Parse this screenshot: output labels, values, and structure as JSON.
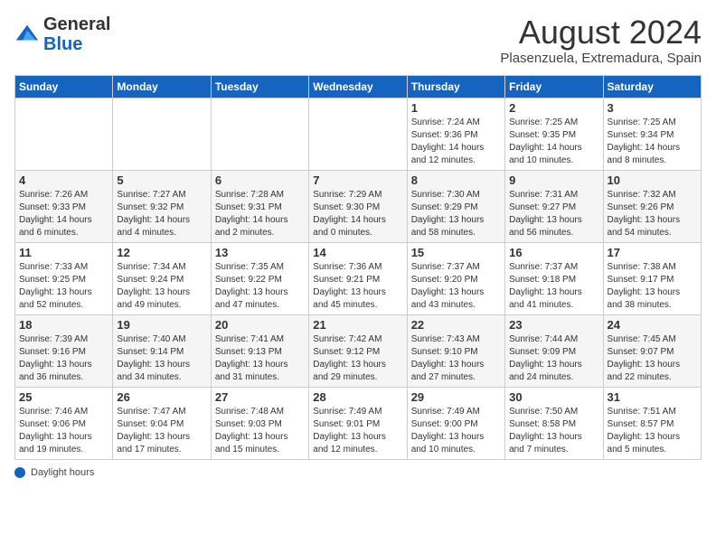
{
  "header": {
    "logo_general": "General",
    "logo_blue": "Blue",
    "month_title": "August 2024",
    "location": "Plasenzuela, Extremadura, Spain"
  },
  "days_of_week": [
    "Sunday",
    "Monday",
    "Tuesday",
    "Wednesday",
    "Thursday",
    "Friday",
    "Saturday"
  ],
  "weeks": [
    [
      {
        "day": "",
        "info": ""
      },
      {
        "day": "",
        "info": ""
      },
      {
        "day": "",
        "info": ""
      },
      {
        "day": "",
        "info": ""
      },
      {
        "day": "1",
        "info": "Sunrise: 7:24 AM\nSunset: 9:36 PM\nDaylight: 14 hours\nand 12 minutes."
      },
      {
        "day": "2",
        "info": "Sunrise: 7:25 AM\nSunset: 9:35 PM\nDaylight: 14 hours\nand 10 minutes."
      },
      {
        "day": "3",
        "info": "Sunrise: 7:25 AM\nSunset: 9:34 PM\nDaylight: 14 hours\nand 8 minutes."
      }
    ],
    [
      {
        "day": "4",
        "info": "Sunrise: 7:26 AM\nSunset: 9:33 PM\nDaylight: 14 hours\nand 6 minutes."
      },
      {
        "day": "5",
        "info": "Sunrise: 7:27 AM\nSunset: 9:32 PM\nDaylight: 14 hours\nand 4 minutes."
      },
      {
        "day": "6",
        "info": "Sunrise: 7:28 AM\nSunset: 9:31 PM\nDaylight: 14 hours\nand 2 minutes."
      },
      {
        "day": "7",
        "info": "Sunrise: 7:29 AM\nSunset: 9:30 PM\nDaylight: 14 hours\nand 0 minutes."
      },
      {
        "day": "8",
        "info": "Sunrise: 7:30 AM\nSunset: 9:29 PM\nDaylight: 13 hours\nand 58 minutes."
      },
      {
        "day": "9",
        "info": "Sunrise: 7:31 AM\nSunset: 9:27 PM\nDaylight: 13 hours\nand 56 minutes."
      },
      {
        "day": "10",
        "info": "Sunrise: 7:32 AM\nSunset: 9:26 PM\nDaylight: 13 hours\nand 54 minutes."
      }
    ],
    [
      {
        "day": "11",
        "info": "Sunrise: 7:33 AM\nSunset: 9:25 PM\nDaylight: 13 hours\nand 52 minutes."
      },
      {
        "day": "12",
        "info": "Sunrise: 7:34 AM\nSunset: 9:24 PM\nDaylight: 13 hours\nand 49 minutes."
      },
      {
        "day": "13",
        "info": "Sunrise: 7:35 AM\nSunset: 9:22 PM\nDaylight: 13 hours\nand 47 minutes."
      },
      {
        "day": "14",
        "info": "Sunrise: 7:36 AM\nSunset: 9:21 PM\nDaylight: 13 hours\nand 45 minutes."
      },
      {
        "day": "15",
        "info": "Sunrise: 7:37 AM\nSunset: 9:20 PM\nDaylight: 13 hours\nand 43 minutes."
      },
      {
        "day": "16",
        "info": "Sunrise: 7:37 AM\nSunset: 9:18 PM\nDaylight: 13 hours\nand 41 minutes."
      },
      {
        "day": "17",
        "info": "Sunrise: 7:38 AM\nSunset: 9:17 PM\nDaylight: 13 hours\nand 38 minutes."
      }
    ],
    [
      {
        "day": "18",
        "info": "Sunrise: 7:39 AM\nSunset: 9:16 PM\nDaylight: 13 hours\nand 36 minutes."
      },
      {
        "day": "19",
        "info": "Sunrise: 7:40 AM\nSunset: 9:14 PM\nDaylight: 13 hours\nand 34 minutes."
      },
      {
        "day": "20",
        "info": "Sunrise: 7:41 AM\nSunset: 9:13 PM\nDaylight: 13 hours\nand 31 minutes."
      },
      {
        "day": "21",
        "info": "Sunrise: 7:42 AM\nSunset: 9:12 PM\nDaylight: 13 hours\nand 29 minutes."
      },
      {
        "day": "22",
        "info": "Sunrise: 7:43 AM\nSunset: 9:10 PM\nDaylight: 13 hours\nand 27 minutes."
      },
      {
        "day": "23",
        "info": "Sunrise: 7:44 AM\nSunset: 9:09 PM\nDaylight: 13 hours\nand 24 minutes."
      },
      {
        "day": "24",
        "info": "Sunrise: 7:45 AM\nSunset: 9:07 PM\nDaylight: 13 hours\nand 22 minutes."
      }
    ],
    [
      {
        "day": "25",
        "info": "Sunrise: 7:46 AM\nSunset: 9:06 PM\nDaylight: 13 hours\nand 19 minutes."
      },
      {
        "day": "26",
        "info": "Sunrise: 7:47 AM\nSunset: 9:04 PM\nDaylight: 13 hours\nand 17 minutes."
      },
      {
        "day": "27",
        "info": "Sunrise: 7:48 AM\nSunset: 9:03 PM\nDaylight: 13 hours\nand 15 minutes."
      },
      {
        "day": "28",
        "info": "Sunrise: 7:49 AM\nSunset: 9:01 PM\nDaylight: 13 hours\nand 12 minutes."
      },
      {
        "day": "29",
        "info": "Sunrise: 7:49 AM\nSunset: 9:00 PM\nDaylight: 13 hours\nand 10 minutes."
      },
      {
        "day": "30",
        "info": "Sunrise: 7:50 AM\nSunset: 8:58 PM\nDaylight: 13 hours\nand 7 minutes."
      },
      {
        "day": "31",
        "info": "Sunrise: 7:51 AM\nSunset: 8:57 PM\nDaylight: 13 hours\nand 5 minutes."
      }
    ]
  ],
  "footer": {
    "daylight_label": "Daylight hours"
  }
}
